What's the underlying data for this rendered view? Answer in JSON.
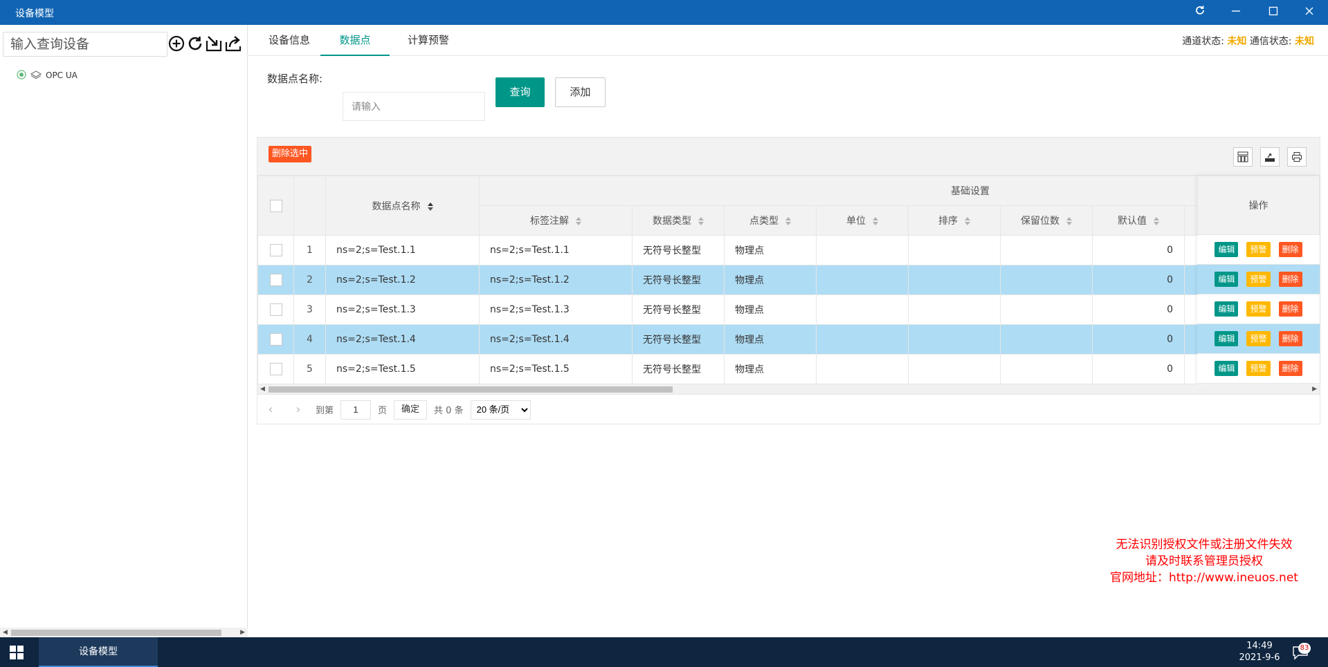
{
  "window": {
    "title": "设备模型"
  },
  "sidebar": {
    "search_placeholder": "输入查询设备",
    "tree": [
      {
        "label": "OPC UA"
      }
    ]
  },
  "tabs": [
    {
      "label": "设备信息"
    },
    {
      "label": "数据点"
    },
    {
      "label": "计算预警"
    }
  ],
  "status": {
    "channel_label": "通道状态:",
    "channel_value": "未知",
    "comm_label": "通信状态:",
    "comm_value": "未知"
  },
  "form": {
    "name_label": "数据点名称:",
    "name_placeholder": "请输入",
    "query_label": "查询",
    "add_label": "添加"
  },
  "table": {
    "delete_selected_label": "删除选中",
    "group_header": "基础设置",
    "headers": {
      "name": "数据点名称",
      "tag": "标签注解",
      "data_type": "数据类型",
      "point_type": "点类型",
      "unit": "单位",
      "order": "排序",
      "decimals": "保留位数",
      "default": "默认值",
      "ops": "操作"
    },
    "rows": [
      {
        "index": "1",
        "name": "ns=2;s=Test.1.1",
        "tag": "ns=2;s=Test.1.1",
        "data_type": "无符号长整型",
        "point_type": "物理点",
        "unit": "",
        "order": "",
        "decimals": "",
        "default": "0",
        "highlighted": false
      },
      {
        "index": "2",
        "name": "ns=2;s=Test.1.2",
        "tag": "ns=2;s=Test.1.2",
        "data_type": "无符号长整型",
        "point_type": "物理点",
        "unit": "",
        "order": "",
        "decimals": "",
        "default": "0",
        "highlighted": true
      },
      {
        "index": "3",
        "name": "ns=2;s=Test.1.3",
        "tag": "ns=2;s=Test.1.3",
        "data_type": "无符号长整型",
        "point_type": "物理点",
        "unit": "",
        "order": "",
        "decimals": "",
        "default": "0",
        "highlighted": false
      },
      {
        "index": "4",
        "name": "ns=2;s=Test.1.4",
        "tag": "ns=2;s=Test.1.4",
        "data_type": "无符号长整型",
        "point_type": "物理点",
        "unit": "",
        "order": "",
        "decimals": "",
        "default": "0",
        "highlighted": true
      },
      {
        "index": "5",
        "name": "ns=2;s=Test.1.5",
        "tag": "ns=2;s=Test.1.5",
        "data_type": "无符号长整型",
        "point_type": "物理点",
        "unit": "",
        "order": "",
        "decimals": "",
        "default": "0",
        "highlighted": false
      }
    ],
    "op_labels": {
      "edit": "编辑",
      "warn": "预警",
      "delete": "删除"
    }
  },
  "pager": {
    "goto_label": "到第",
    "page_value": "1",
    "page_label": "页",
    "confirm_label": "确定",
    "total_label": "共 0 条",
    "page_size_options": [
      "20 条/页"
    ]
  },
  "license_warning": [
    "无法识别授权文件或注册文件失效",
    "请及时联系管理员授权",
    "官网地址：http://www.ineuos.net"
  ],
  "taskbar": {
    "app_label": "设备模型",
    "time": "14:49",
    "date": "2021-9-6",
    "notification_count": "83"
  },
  "colors": {
    "titlebar": "#1164b4",
    "primary": "#009688",
    "danger": "#ff5722",
    "warn": "#ffb800",
    "highlight_row": "#aedcf4",
    "status_value": "#f0a800",
    "taskbar": "#0f2540"
  },
  "icons": [
    "add-icon",
    "refresh-icon",
    "import-icon",
    "export-icon",
    "columns-icon",
    "export-table-icon",
    "print-icon",
    "windows-icon",
    "notification-icon"
  ]
}
